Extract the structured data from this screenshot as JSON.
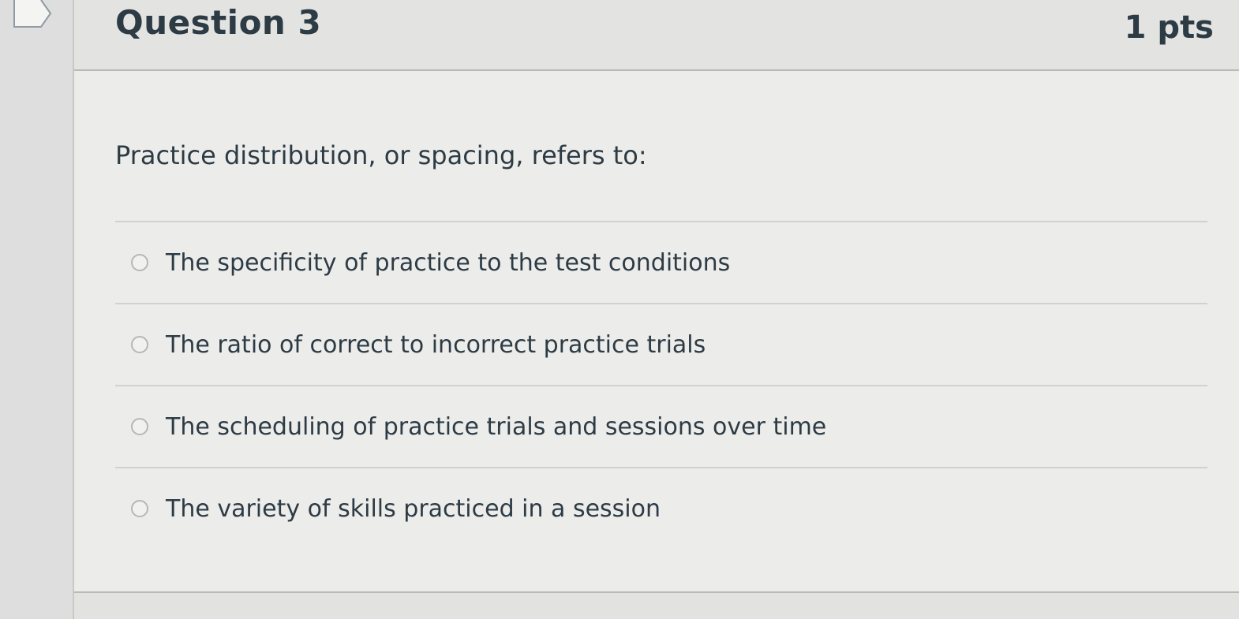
{
  "question": {
    "title": "Question 3",
    "points": "1 pts",
    "prompt": "Practice distribution, or spacing, refers to:",
    "answers": [
      {
        "label": "The specificity of practice to the test conditions",
        "selected": false
      },
      {
        "label": "The ratio of correct to incorrect practice trials",
        "selected": false
      },
      {
        "label": "The scheduling of practice trials and sessions over time",
        "selected": false
      },
      {
        "label": "The variety of skills practiced in a session",
        "selected": false
      }
    ]
  },
  "icons": {
    "flag": "flag-icon",
    "radio": "radio-button-icon"
  }
}
